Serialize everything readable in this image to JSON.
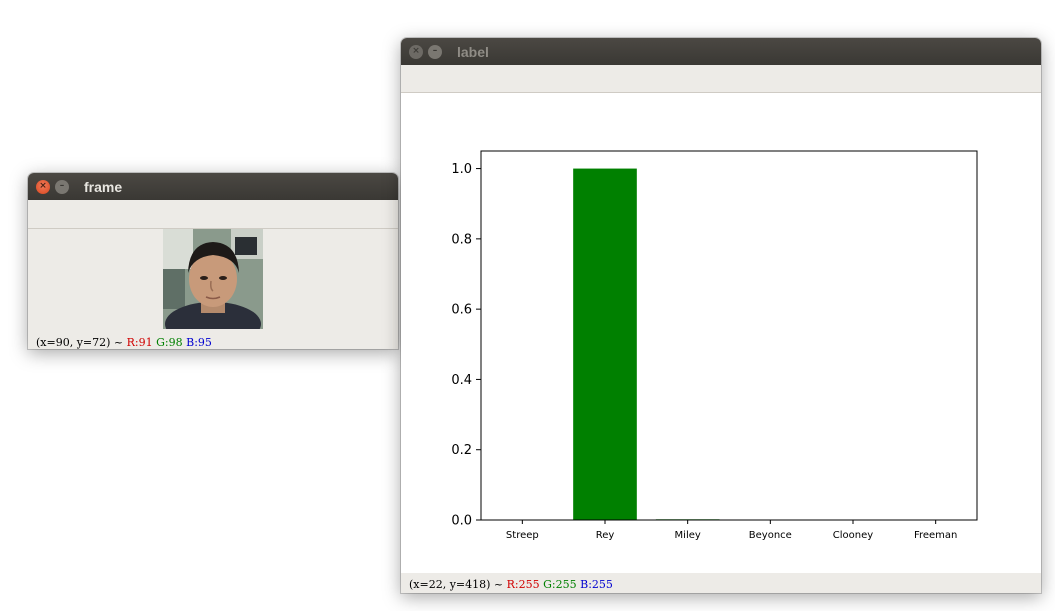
{
  "frame_window": {
    "title": "frame",
    "status": {
      "coords": "(x=90, y=72) ~",
      "r": "R:91",
      "g": "G:98",
      "b": "B:95"
    }
  },
  "label_window": {
    "title": "label",
    "status": {
      "coords": "(x=22, y=418) ~",
      "r": "R:255",
      "g": "G:255",
      "b": "B:255"
    }
  },
  "icons": {
    "close": "close-icon",
    "minimize": "minimize-icon"
  },
  "colors": {
    "bar": "#008000"
  },
  "chart_data": {
    "type": "bar",
    "categories": [
      "Streep",
      "Rey",
      "Miley",
      "Beyonce",
      "Clooney",
      "Freeman"
    ],
    "values": [
      0.0,
      1.0,
      0.002,
      0.0,
      0.0,
      0.0
    ],
    "title": "",
    "xlabel": "",
    "ylabel": "",
    "ylim": [
      0,
      1.05
    ],
    "yticks": [
      "0.0",
      "0.2",
      "0.4",
      "0.6",
      "0.8",
      "1.0"
    ],
    "grid": false
  }
}
